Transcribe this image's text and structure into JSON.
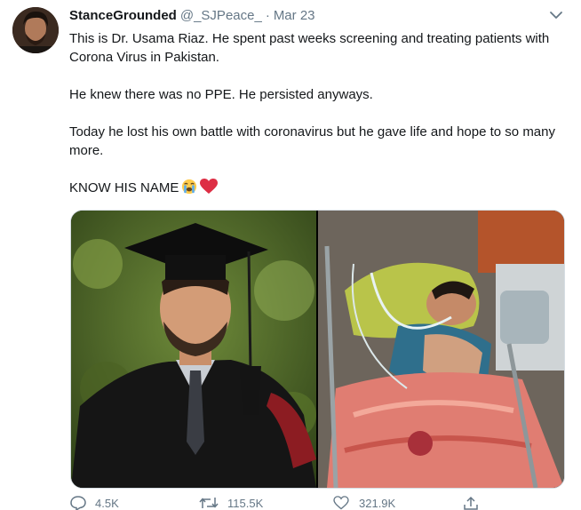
{
  "tweet": {
    "display_name": "StanceGrounded",
    "handle": "@_SJPeace_",
    "separator": "·",
    "date": "Mar 23",
    "paragraphs": [
      "This is Dr. Usama Riaz. He spent past weeks screening and treating patients with Corona Virus in Pakistan.",
      "He knew there was no PPE. He persisted anyways.",
      "Today he lost his own battle with coronavirus but he gave life and hope to so many more.",
      "KNOW HIS NAME"
    ],
    "emojis": [
      "loudly-crying-face",
      "red-heart"
    ]
  },
  "actions": {
    "replies": "4.5K",
    "retweets": "115.5K",
    "likes": "321.9K"
  },
  "colors": {
    "text": "#14171a",
    "secondary": "#657786",
    "heart": "#e0245e"
  }
}
